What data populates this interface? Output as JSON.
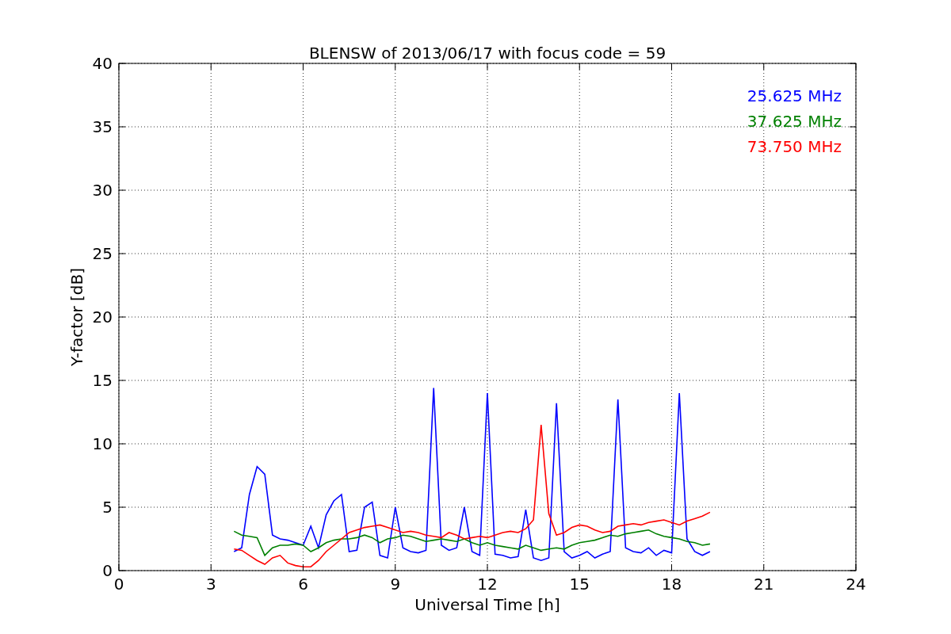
{
  "chart_data": {
    "type": "line",
    "title": "BLENSW of 2013/06/17 with focus code = 59",
    "xlabel": "Universal Time [h]",
    "ylabel": "Y-factor [dB]",
    "x": [
      3.75,
      4,
      4.25,
      4.5,
      4.75,
      5,
      5.25,
      5.5,
      5.75,
      6,
      6.25,
      6.5,
      6.75,
      7,
      7.25,
      7.5,
      7.75,
      8,
      8.25,
      8.5,
      8.75,
      9,
      9.25,
      9.5,
      9.75,
      10,
      10.25,
      10.5,
      10.75,
      11,
      11.25,
      11.5,
      11.75,
      12,
      12.25,
      12.5,
      12.75,
      13,
      13.25,
      13.5,
      13.75,
      14,
      14.25,
      14.5,
      14.75,
      15,
      15.25,
      15.5,
      15.75,
      16,
      16.25,
      16.5,
      16.75,
      17,
      17.25,
      17.5,
      17.75,
      18,
      18.25,
      18.5,
      18.75,
      19,
      19.25
    ],
    "series": [
      {
        "name": "25.625 MHz",
        "color": "#0000ff",
        "values": [
          1.5,
          1.8,
          6.0,
          8.2,
          7.6,
          2.8,
          2.5,
          2.4,
          2.2,
          2.0,
          3.5,
          1.8,
          4.4,
          5.5,
          6.0,
          1.5,
          1.6,
          5.0,
          5.4,
          1.2,
          1.0,
          5.0,
          1.8,
          1.5,
          1.4,
          1.6,
          14.4,
          2.0,
          1.6,
          1.8,
          5.0,
          1.5,
          1.2,
          14.0,
          1.3,
          1.2,
          1.0,
          1.1,
          4.8,
          1.0,
          0.8,
          1.0,
          13.2,
          1.5,
          1.0,
          1.2,
          1.5,
          1.0,
          1.3,
          1.5,
          13.5,
          1.8,
          1.5,
          1.4,
          1.8,
          1.2,
          1.6,
          1.4,
          14.0,
          2.5,
          1.5,
          1.2,
          1.5
        ]
      },
      {
        "name": "37.625 MHz",
        "color": "#008000",
        "values": [
          3.1,
          2.8,
          2.7,
          2.6,
          1.2,
          1.8,
          2.0,
          2.0,
          2.1,
          2.0,
          1.5,
          1.8,
          2.2,
          2.4,
          2.5,
          2.5,
          2.6,
          2.8,
          2.6,
          2.2,
          2.5,
          2.6,
          2.8,
          2.7,
          2.5,
          2.3,
          2.4,
          2.5,
          2.4,
          2.3,
          2.5,
          2.2,
          2.0,
          2.2,
          2.0,
          1.9,
          1.8,
          1.7,
          2.0,
          1.8,
          1.6,
          1.7,
          1.8,
          1.7,
          2.0,
          2.2,
          2.3,
          2.4,
          2.6,
          2.8,
          2.7,
          2.9,
          3.0,
          3.1,
          3.2,
          2.9,
          2.7,
          2.6,
          2.5,
          2.3,
          2.2,
          2.0,
          2.1
        ]
      },
      {
        "name": "73.750 MHz",
        "color": "#ff0000",
        "values": [
          1.7,
          1.6,
          1.2,
          0.8,
          0.5,
          1.0,
          1.2,
          0.6,
          0.4,
          0.3,
          0.3,
          0.8,
          1.5,
          2.0,
          2.5,
          3.0,
          3.2,
          3.4,
          3.5,
          3.6,
          3.4,
          3.2,
          3.0,
          3.1,
          3.0,
          2.8,
          2.7,
          2.6,
          3.0,
          2.8,
          2.5,
          2.6,
          2.7,
          2.6,
          2.8,
          3.0,
          3.1,
          3.0,
          3.3,
          4.0,
          11.5,
          4.5,
          2.8,
          3.0,
          3.4,
          3.6,
          3.5,
          3.2,
          3.0,
          3.1,
          3.5,
          3.6,
          3.7,
          3.6,
          3.8,
          3.9,
          4.0,
          3.8,
          3.6,
          3.9,
          4.1,
          4.3,
          4.6
        ]
      }
    ],
    "grid": true,
    "xlim": [
      0,
      24
    ],
    "ylim": [
      0,
      40
    ],
    "xticks": [
      0,
      3,
      6,
      9,
      12,
      15,
      18,
      21,
      24
    ],
    "yticks": [
      0,
      5,
      10,
      15,
      20,
      25,
      30,
      35,
      40
    ]
  }
}
